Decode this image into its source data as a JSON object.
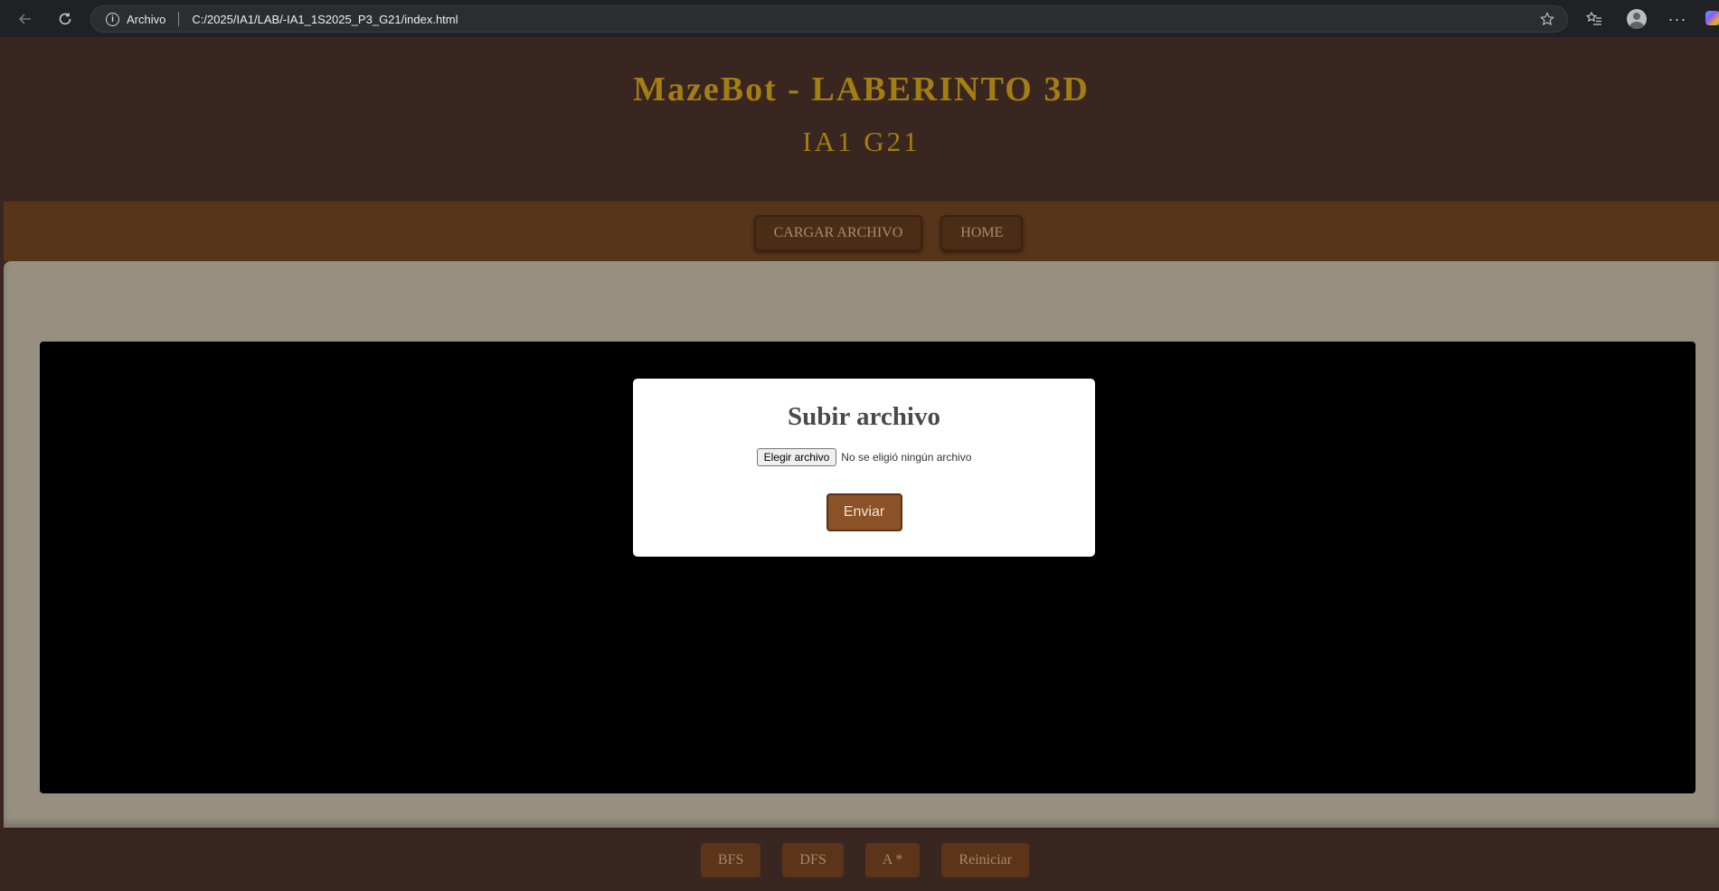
{
  "browser": {
    "scheme_label": "Archivo",
    "url": "C:/2025/IA1/LAB/-IA1_1S2025_P3_G21/index.html",
    "icons": [
      "back-arrow-icon",
      "reload-icon",
      "info-icon",
      "star-icon",
      "favorites-icon",
      "profile-icon",
      "more-icon",
      "copilot-icon"
    ]
  },
  "header": {
    "title": "MazeBot - LABERINTO 3D",
    "subtitle": "IA1 G21"
  },
  "nav": {
    "load_file": "CARGAR ARCHIVO",
    "home": "HOME"
  },
  "modal": {
    "title": "Subir archivo",
    "choose_file": "Elegir archivo",
    "no_file": "No se eligió ningún archivo",
    "submit": "Enviar"
  },
  "footer": {
    "buttons": [
      "BFS",
      "DFS",
      "A *",
      "Reiniciar"
    ]
  },
  "colors": {
    "header_bg": "#3a2621",
    "title_gold": "#a37e12",
    "nav_bg": "#56351a",
    "content_bg": "#979080",
    "submit_bg": "#8a5226"
  }
}
